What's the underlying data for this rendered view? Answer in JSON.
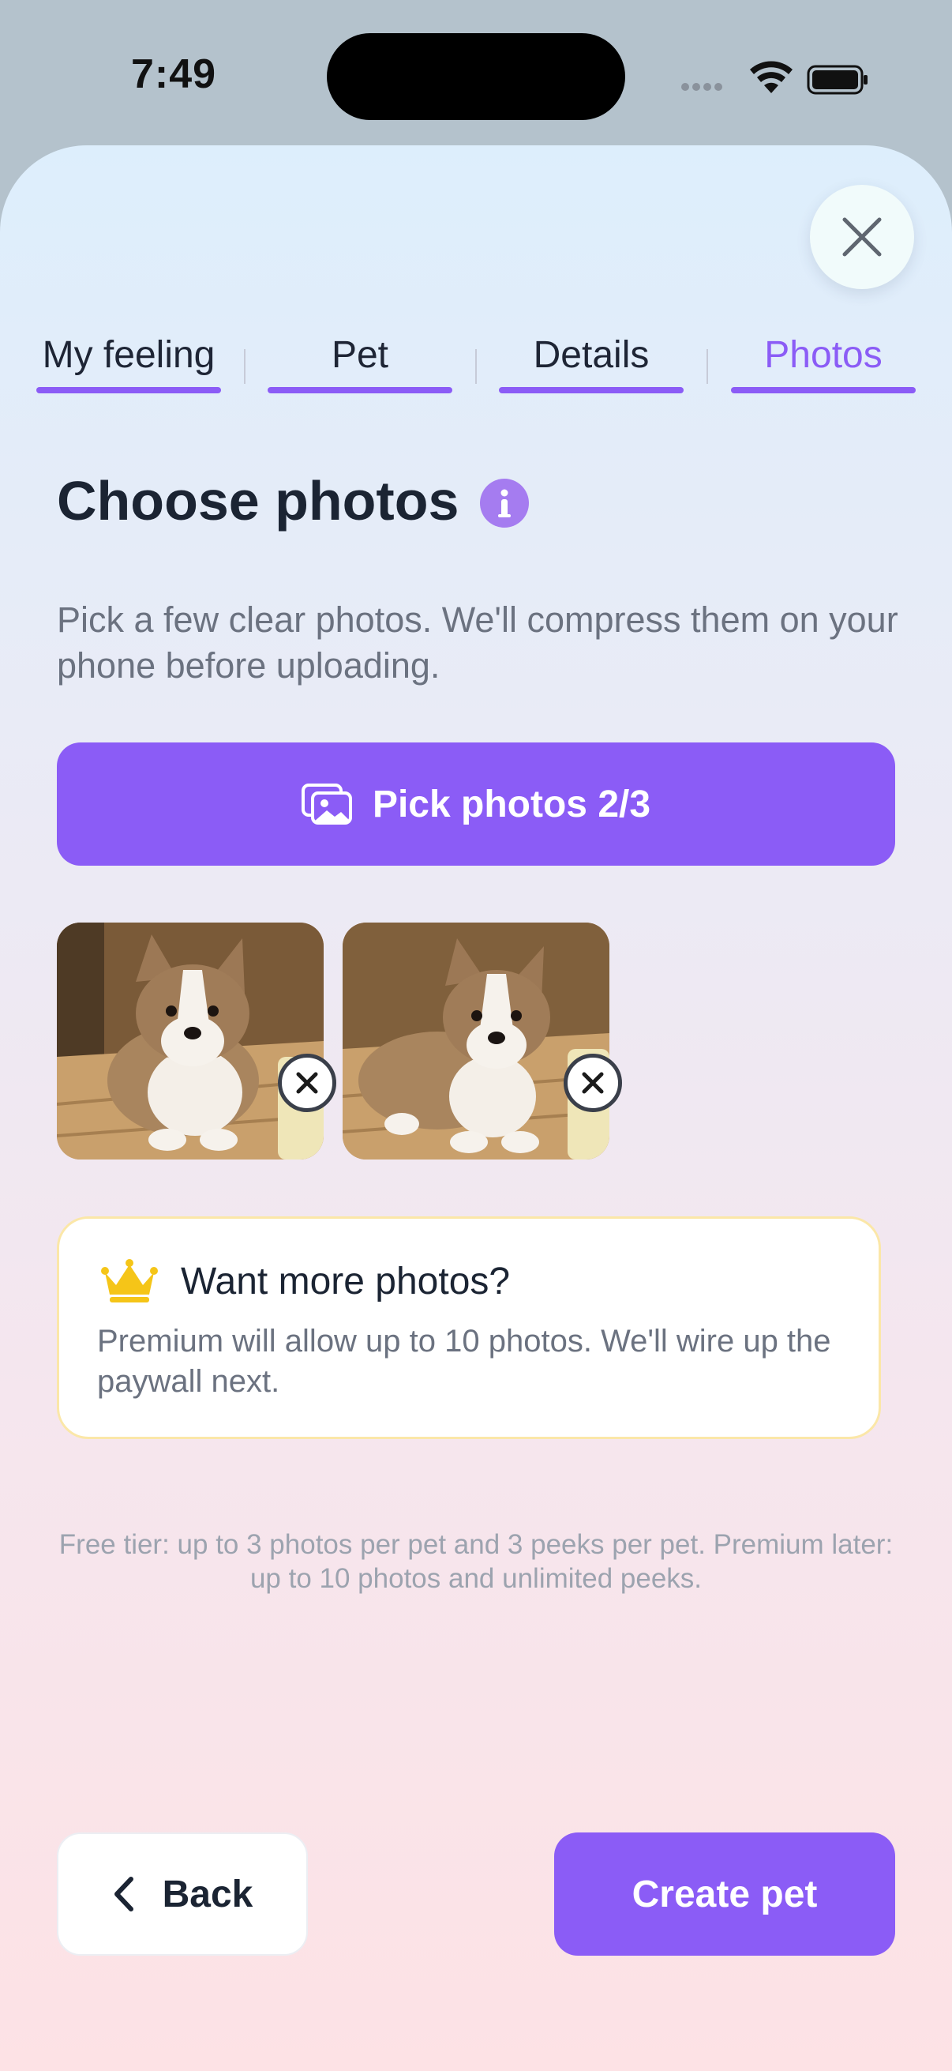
{
  "status_bar": {
    "time": "7:49",
    "icons": [
      "signal-dots-icon",
      "wifi-icon",
      "battery-icon"
    ]
  },
  "sheet": {
    "close_icon": "close-icon",
    "tabs": [
      {
        "label": "My feeling",
        "active": false
      },
      {
        "label": "Pet",
        "active": false
      },
      {
        "label": "Details",
        "active": false
      },
      {
        "label": "Photos",
        "active": true
      }
    ],
    "title": "Choose photos",
    "title_icon": "info-icon",
    "subtitle": "Pick a few clear photos. We'll compress them on your phone before uploading.",
    "pick_button": {
      "label": "Pick photos 2/3",
      "icon": "photos-icon"
    },
    "photos": [
      {
        "alt": "corgi-puppy-photo-1",
        "remove_icon": "remove-icon"
      },
      {
        "alt": "corgi-puppy-photo-2",
        "remove_icon": "remove-icon"
      }
    ],
    "promo": {
      "icon": "crown-icon",
      "title": "Want more photos?",
      "body": "Premium will allow up to 10 photos. We'll wire up the paywall next."
    },
    "footer_note": "Free tier: up to 3 photos per pet and 3 peeks per pet. Premium later: up to 10 photos and unlimited peeks.",
    "back_button": {
      "label": "Back",
      "icon": "chevron-left-icon"
    },
    "create_button": {
      "label": "Create pet"
    }
  },
  "colors": {
    "accent": "#8b5cf6",
    "crown": "#f5c518",
    "text_primary": "#1b2433",
    "text_secondary": "#6b7280"
  }
}
